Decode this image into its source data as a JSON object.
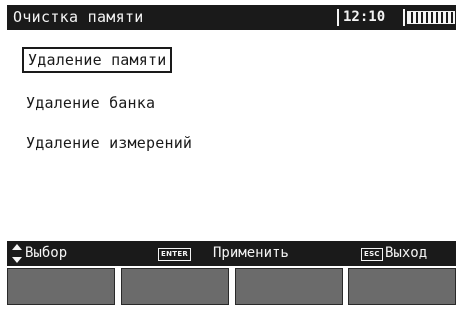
{
  "header": {
    "title": "Очистка памяти",
    "clock": "12:10",
    "battery_icon": "battery-full-icon"
  },
  "menu": {
    "items": [
      {
        "label": "Удаление памяти",
        "selected": true
      },
      {
        "label": "Удаление банка",
        "selected": false
      },
      {
        "label": "Удаление измерений",
        "selected": false
      }
    ]
  },
  "hints": {
    "updown_icon": "up-down-arrows-icon",
    "select_label": "Выбор",
    "enter_key": "ENTER",
    "apply_label": "Применить",
    "esc_key": "ESC",
    "exit_label": "Выход"
  },
  "colors": {
    "bar_background": "#1a1a1a",
    "bar_text": "#f4f4f4",
    "softkey": "#6b6b6b"
  }
}
